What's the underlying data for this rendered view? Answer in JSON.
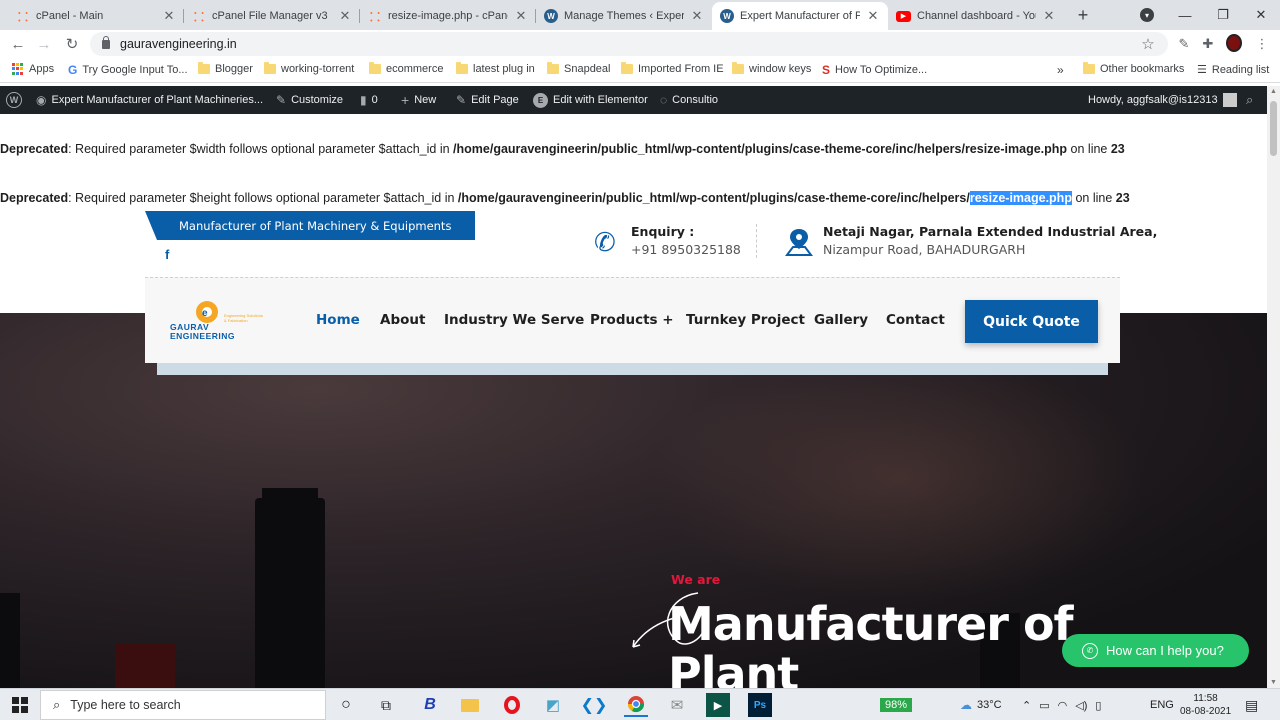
{
  "tabs": [
    {
      "title": "cPanel - Main",
      "icon": "cpanel-icon"
    },
    {
      "title": "cPanel File Manager v3",
      "icon": "cpanel-icon"
    },
    {
      "title": "resize-image.php - cPanel F",
      "icon": "cpanel-icon"
    },
    {
      "title": "Manage Themes ‹ Expert M",
      "icon": "wordpress-icon"
    },
    {
      "title": "Expert Manufacturer of Plan",
      "icon": "wordpress-icon",
      "active": true
    },
    {
      "title": "Channel dashboard - YouTu",
      "icon": "youtube-icon"
    }
  ],
  "address": {
    "url": "gauravengineering.in"
  },
  "bookmarks": {
    "apps": "Apps",
    "items": [
      "Try Google Input To...",
      "Blogger",
      "working-torrent",
      "ecommerce",
      "latest plug in",
      "Snapdeal",
      "Imported From IE",
      "window keys",
      "How To Optimize..."
    ],
    "more": "»",
    "other": "Other bookmarks",
    "reading_list": "Reading list"
  },
  "wpbar": {
    "site": "Expert Manufacturer of Plant Machineries...",
    "customize": "Customize",
    "comments": "0",
    "new": "New",
    "edit_page": "Edit Page",
    "elementor": "Edit with Elementor",
    "theme": "Consultio",
    "howdy": "Howdy, aggfsalk@is12313"
  },
  "notices": [
    {
      "label": "Deprecated",
      "text": ": Required parameter $width follows optional parameter $attach_id in ",
      "path": "/home/gauravengineerin/public_html/wp-content/plugins/case-theme-core/inc/helpers/resize-image.php",
      "path_tail": "",
      "online": " on line ",
      "line": "23"
    },
    {
      "label": "Deprecated",
      "text": ": Required parameter $height follows optional parameter $attach_id in ",
      "path": "/home/gauravengineerin/public_html/wp-content/plugins/case-theme-core/inc/helpers/",
      "path_tail": "resize-image.php",
      "online": " on line ",
      "line": "23"
    }
  ],
  "site": {
    "ribbon": "Manufacturer of Plant Machinery & Equipments",
    "enquiry_label": "Enquiry :",
    "phone": "+91 8950325188",
    "address_line1": "Netaji Nagar, Parnala Extended Industrial Area,",
    "address_line2": "Nizampur Road, BAHADURGARH",
    "logo_name": "GAURAV",
    "logo_sub": "ENGINEERING",
    "logo_tagline": "Engineering Solutions & Fabrication",
    "nav": [
      "Home",
      "About",
      "Industry We Serve",
      "Products +",
      "Turnkey Project",
      "Gallery",
      "Contact"
    ],
    "quote": "Quick Quote",
    "hero_kicker": "We are",
    "hero_title_1": "Manufacturer of",
    "hero_title_2": "Plant",
    "whatsapp": "How can I help you?",
    "colors": {
      "primary": "#0a5ea8",
      "kicker": "#e3173d",
      "whatsapp": "#27c46b"
    }
  },
  "taskbar": {
    "search_placeholder": "Type here to search",
    "battery": "98%",
    "temp": "33°C",
    "lang": "ENG",
    "time": "11:58",
    "date": "08-08-2021"
  }
}
